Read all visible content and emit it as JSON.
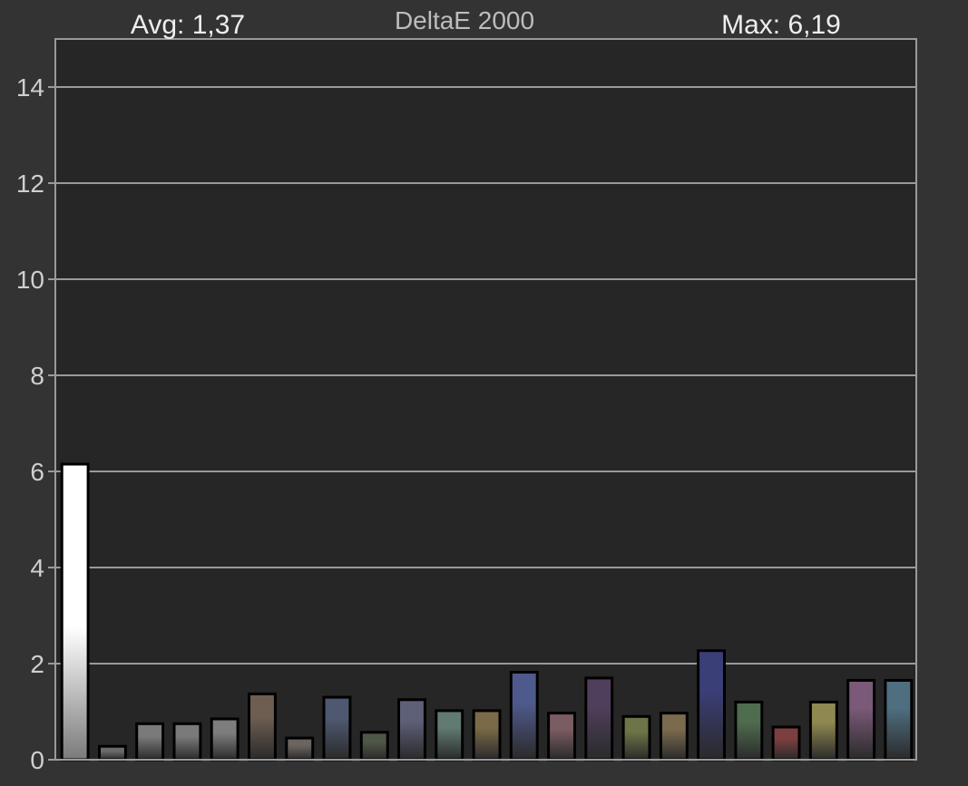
{
  "chart_data": {
    "type": "bar",
    "title": "DeltaE 2000",
    "avg_label": "Avg: 1,37",
    "max_label": "Max: 6,19",
    "xlabel": "",
    "ylabel": "",
    "ylim": [
      0,
      15
    ],
    "yticks": [
      "0",
      "2",
      "4",
      "6",
      "8",
      "10",
      "12",
      "14"
    ],
    "grid": true,
    "values": [
      6.15,
      0.28,
      0.75,
      0.75,
      0.85,
      1.37,
      0.45,
      1.3,
      0.57,
      1.25,
      1.02,
      1.02,
      1.82,
      0.97,
      1.7,
      0.9,
      0.97,
      2.27,
      1.2,
      0.68,
      1.2,
      1.65,
      1.65
    ],
    "colors": [
      "#ffffff",
      "#6b6b6b",
      "#7a7a7a",
      "#7a7a7a",
      "#7d7d7d",
      "#6e5e52",
      "#6b6460",
      "#4e5870",
      "#4f5748",
      "#5e6078",
      "#617a72",
      "#7a6a48",
      "#4f5a8c",
      "#7a5c62",
      "#4f3f5c",
      "#6c7448",
      "#7a6a4e",
      "#3b3f78",
      "#4f6c4e",
      "#7c3f3f",
      "#8f8850",
      "#7a5a78",
      "#4f6e80"
    ]
  },
  "colors": {
    "background": "#333333",
    "plot_background": "#262626",
    "frame": "#9a9a9a",
    "grid": "#9a9a9a",
    "text": "#cfcfcf",
    "bar_outline": "#000000"
  }
}
